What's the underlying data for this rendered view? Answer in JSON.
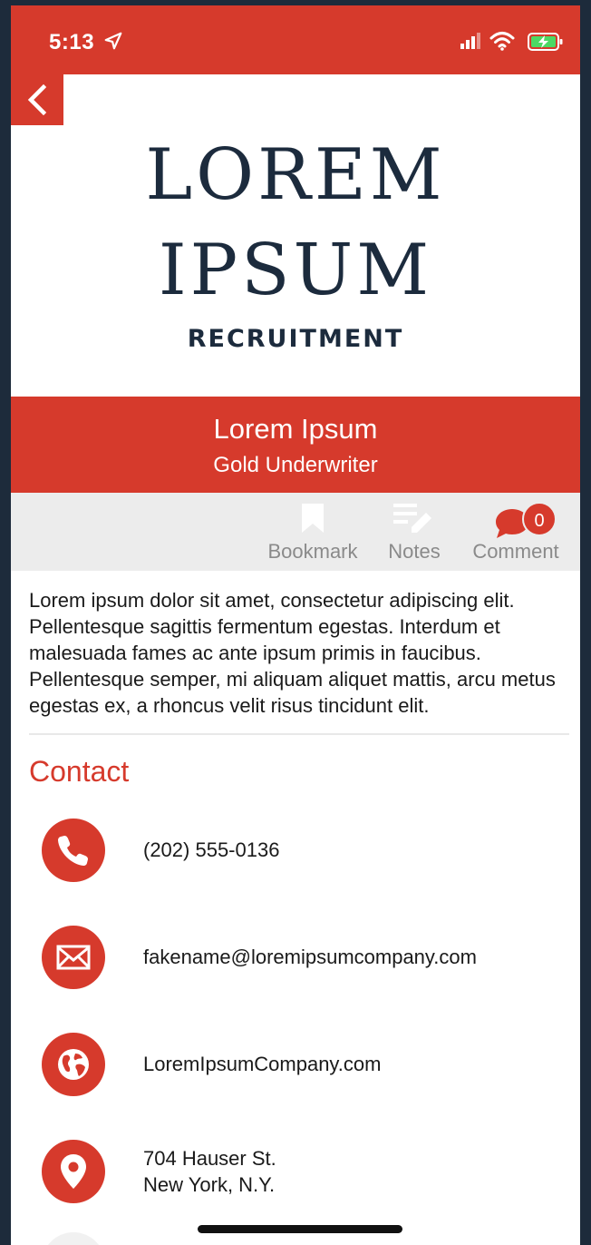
{
  "status_bar": {
    "time": "5:13"
  },
  "logo": {
    "line1": "LOREM",
    "line2": "IPSUM",
    "line3": "RECRUITMENT"
  },
  "profile": {
    "name": "Lorem Ipsum",
    "role": "Gold Underwriter"
  },
  "actions": {
    "bookmark_label": "Bookmark",
    "notes_label": "Notes",
    "comment_label": "Comment",
    "comment_count": "0"
  },
  "description": "Lorem ipsum dolor sit amet, consectetur adipiscing elit. Pellentesque sagittis fermentum egestas. Interdum et malesuada fames ac ante ipsum primis in faucibus. Pellentesque semper, mi aliquam aliquet mattis, arcu metus egestas ex, a rhoncus velit risus tincidunt elit.",
  "contact": {
    "title": "Contact",
    "phone": "(202) 555-0136",
    "email": "fakename@loremipsumcompany.com",
    "website": "LoremIpsumCompany.com",
    "address_line1": "704 Hauser St.",
    "address_line2": "New York, N.Y."
  },
  "colors": {
    "accent": "#d63a2c",
    "logo_navy": "#1c2b3d",
    "action_bar_bg": "#ececec"
  },
  "icons": [
    "location-arrow-icon",
    "signal-icon",
    "wifi-icon",
    "battery-charging-icon",
    "chevron-left-icon",
    "bookmark-icon",
    "notes-icon",
    "comment-icon",
    "phone-icon",
    "envelope-icon",
    "globe-icon",
    "map-pin-icon"
  ]
}
